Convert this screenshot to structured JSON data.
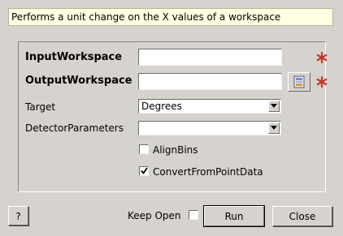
{
  "description": "Performs a unit change on the X values of a workspace",
  "fields": {
    "input_workspace": {
      "label": "InputWorkspace",
      "value": "",
      "required_marker": "*"
    },
    "output_workspace": {
      "label": "OutputWorkspace",
      "value": "",
      "required_marker": "*"
    },
    "target": {
      "label": "Target",
      "selected": "Degrees"
    },
    "detector_parameters": {
      "label": "DetectorParameters",
      "selected": ""
    },
    "align_bins": {
      "label": "AlignBins",
      "checked": false
    },
    "convert_from_point_data": {
      "label": "ConvertFromPointData",
      "checked": true
    }
  },
  "footer": {
    "help_label": "?",
    "keep_open_label": "Keep Open",
    "keep_open_checked": false,
    "run_label": "Run",
    "close_label": "Close"
  },
  "colors": {
    "required_star": "#c0392b",
    "description_background": "#ffffe1",
    "dialog_background": "#d6d3ce"
  },
  "icons": {
    "browse": "workspace-browse-icon",
    "required": "required-star-icon",
    "combo_arrow": "chevron-down-icon",
    "check": "check-icon"
  }
}
